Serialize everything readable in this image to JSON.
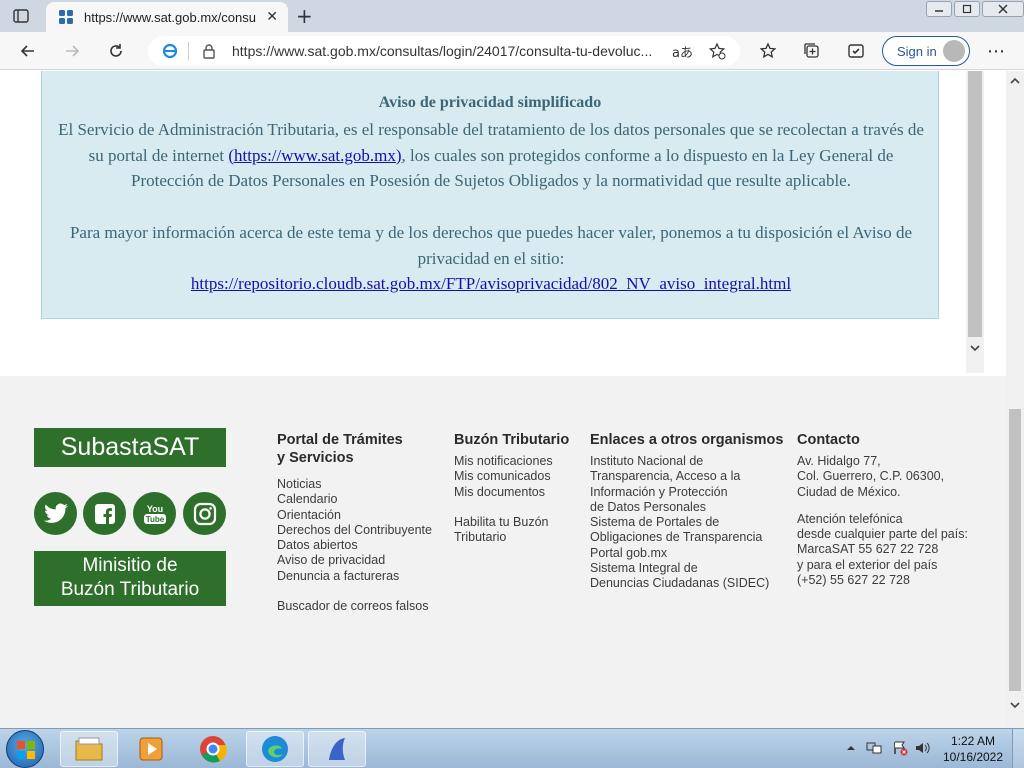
{
  "browser": {
    "tab_title": "https://www.sat.gob.mx/consulta",
    "tab_close": "✕",
    "new_tab": "+",
    "url": "https://www.sat.gob.mx/consultas/login/24017/consulta-tu-devoluc...",
    "signin_label": "Sign in",
    "more_label": "⋯",
    "read_aloud": "aあ"
  },
  "notice": {
    "title": "Aviso de privacidad simplificado",
    "p1_text1": "El Servicio de Administración Tributaria, es el responsable del tratamiento de los datos personales que se recolectan a través de su portal de internet ",
    "p1_link": "(https://www.sat.gob.mx)",
    "p1_text2": ", los cuales son protegidos conforme a lo dispuesto en la Ley General de Protección de Datos Personales en Posesión de Sujetos Obligados y la normatividad que resulte aplicable.",
    "p2_text": "Para mayor información acerca de este tema y de los derechos que puedes hacer valer, ponemos a tu disposición el Aviso de privacidad en el sitio:",
    "p2_link": "https://repositorio.cloudb.sat.gob.mx/FTP/avisoprivacidad/802_NV_aviso_integral.html"
  },
  "footer": {
    "subasta_label": "SubastaSAT",
    "buzon_line1": "Minisitio de",
    "buzon_line2": "Buzón Tributario",
    "brand_color": "#2e6f2c",
    "portal": {
      "heading1": "Portal de Trámites",
      "heading2": "y Servicios",
      "links": [
        "Noticias",
        "Calendario",
        "Orientación",
        "Derechos del Contribuyente",
        "Datos abiertos",
        "Aviso de privacidad",
        "Denuncia a factureras"
      ],
      "extra_link": "Buscador de correos falsos"
    },
    "buzon": {
      "heading": "Buzón Tributario",
      "links": [
        "Mis notificaciones",
        "Mis comunicados",
        "Mis documentos"
      ],
      "extra1": "Habilita tu Buzón",
      "extra2": "Tributario"
    },
    "enlaces": {
      "heading": "Enlaces a otros organismos",
      "lines": [
        "Instituto Nacional de",
        "Transparencia, Acceso a la",
        "Información y Protección",
        "de Datos Personales",
        "Sistema de Portales de",
        "Obligaciones de Transparencia",
        "Portal gob.mx",
        "Sistema Integral de",
        "Denuncias Ciudadanas (SIDEC)"
      ]
    },
    "contacto": {
      "heading": "Contacto",
      "address": [
        "Av. Hidalgo 77,",
        "Col. Guerrero, C.P. 06300,",
        "Ciudad de México."
      ],
      "phone": [
        "Atención telefónica",
        "desde cualquier parte del país:",
        "MarcaSAT 55 627 22 728",
        "y para el exterior del país",
        "(+52) 55 627 22 728"
      ]
    }
  },
  "taskbar": {
    "time": "1:22 AM",
    "date": "10/16/2022"
  }
}
